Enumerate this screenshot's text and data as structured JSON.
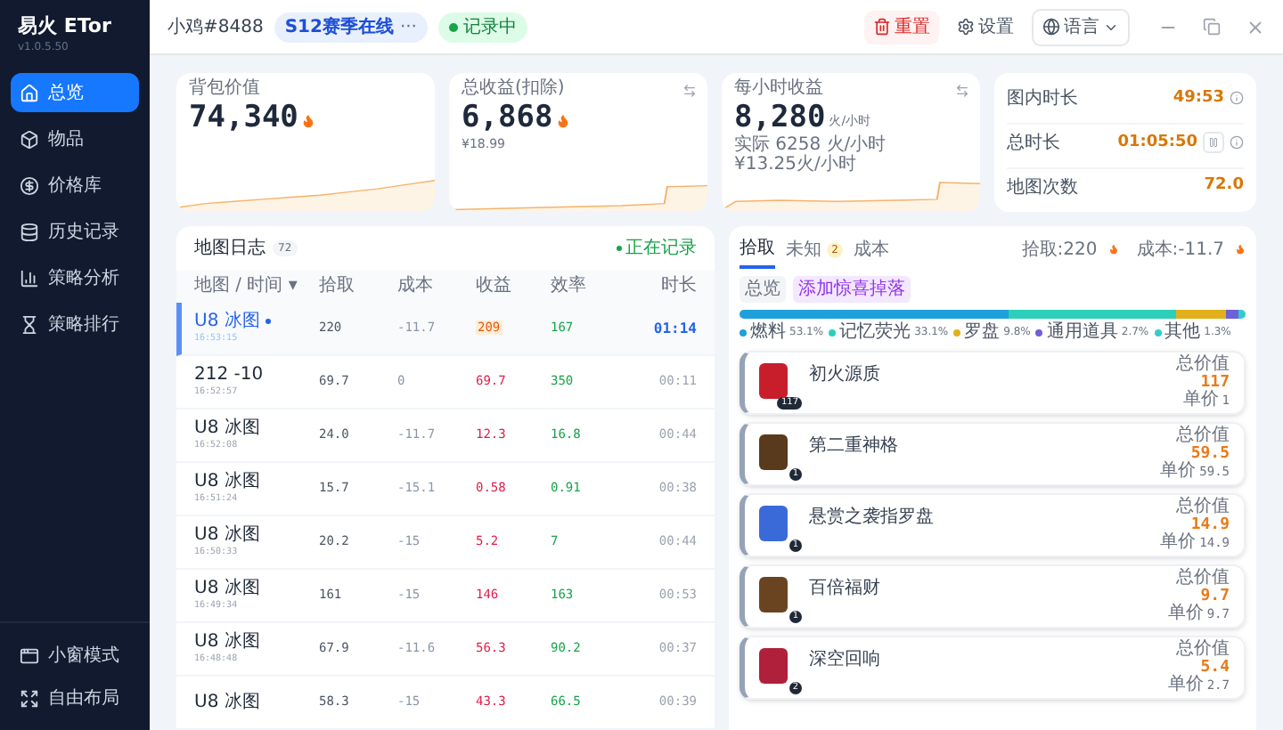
{
  "app": {
    "title": "易火 ETor",
    "version": "v1.0.5.50"
  },
  "sidebar": {
    "items": [
      {
        "label": "总览",
        "selected": true
      },
      {
        "label": "物品",
        "selected": false
      },
      {
        "label": "价格库",
        "selected": false
      },
      {
        "label": "历史记录",
        "selected": false
      },
      {
        "label": "策略分析",
        "selected": false
      },
      {
        "label": "策略排行",
        "selected": false
      }
    ],
    "bottom_items": [
      {
        "label": "小窗模式"
      },
      {
        "label": "自由布局"
      }
    ]
  },
  "header": {
    "user": "小鸡#8488",
    "season": "S12赛季在线",
    "season_more": "···",
    "recording": "记录中",
    "reset": "重置",
    "settings": "设置",
    "language": "语言"
  },
  "stats": [
    {
      "label": "背包价值",
      "value": "74,340",
      "swap": false
    },
    {
      "label": "总收益(扣除)",
      "value": "6,868",
      "sub": [
        "¥18.99"
      ],
      "swap": true
    },
    {
      "label": "每小时收益",
      "value": "8,280",
      "unit": "火/小时",
      "sub": [
        "实际 6258 火/小时",
        "¥13.25火/小时"
      ],
      "swap": true
    }
  ],
  "timers": [
    {
      "label": "图内时长",
      "value": "49:53",
      "pause": false,
      "info": true
    },
    {
      "label": "总时长",
      "value": "01:05:50",
      "pause": true,
      "info": true
    },
    {
      "label": "地图次数",
      "value": "72.0",
      "pause": false,
      "info": false
    }
  ],
  "map_log": {
    "title": "地图日志",
    "count": "72",
    "status": "正在记录",
    "columns": [
      "地图 / 时间 ▾",
      "拾取",
      "成本",
      "收益",
      "效率",
      "时长"
    ],
    "rows": [
      {
        "name": "U8 冰图",
        "time": "16:53:15",
        "pickup": "220",
        "cost": "-11.7",
        "profit": "209",
        "rate": "167",
        "duration": "01:14",
        "selected": true
      },
      {
        "name": "212 -10",
        "time": "16:52:57",
        "pickup": "69.7",
        "cost": "0",
        "profit": "69.7",
        "rate": "350",
        "duration": "00:11",
        "selected": false
      },
      {
        "name": "U8 冰图",
        "time": "16:52:08",
        "pickup": "24.0",
        "cost": "-11.7",
        "profit": "12.3",
        "rate": "16.8",
        "duration": "00:44",
        "selected": false
      },
      {
        "name": "U8 冰图",
        "time": "16:51:24",
        "pickup": "15.7",
        "cost": "-15.1",
        "profit": "0.58",
        "rate": "0.91",
        "duration": "00:38",
        "selected": false
      },
      {
        "name": "U8 冰图",
        "time": "16:50:33",
        "pickup": "20.2",
        "cost": "-15",
        "profit": "5.2",
        "rate": "7",
        "duration": "00:44",
        "selected": false
      },
      {
        "name": "U8 冰图",
        "time": "16:49:34",
        "pickup": "161",
        "cost": "-15",
        "profit": "146",
        "rate": "163",
        "duration": "00:53",
        "selected": false
      },
      {
        "name": "U8 冰图",
        "time": "16:48:48",
        "pickup": "67.9",
        "cost": "-11.6",
        "profit": "56.3",
        "rate": "90.2",
        "duration": "00:37",
        "selected": false
      },
      {
        "name": "U8 冰图",
        "pickup": "58.3",
        "cost": "-15",
        "profit": "43.3",
        "rate": "66.5",
        "duration": "00:39",
        "selected": false
      }
    ]
  },
  "loot": {
    "tabs": [
      {
        "label": "拾取",
        "selected": true
      },
      {
        "label": "未知",
        "badge": "2",
        "selected": false
      },
      {
        "label": "成本",
        "selected": false
      }
    ],
    "pickup_total": "拾取:220",
    "cost_total": "成本:-11.7",
    "chips": [
      {
        "label": "总览",
        "kind": "plain"
      },
      {
        "label": "添加惊喜掉落",
        "kind": "accent"
      }
    ],
    "breakdown": [
      {
        "label": "燃料",
        "percent": "53.1%",
        "color": "#1ea0dc"
      },
      {
        "label": "记忆荧光",
        "percent": "33.1%",
        "color": "#2dcfb8"
      },
      {
        "label": "罗盘",
        "percent": "9.8%",
        "color": "#e2b01c"
      },
      {
        "label": "通用道具",
        "percent": "2.7%",
        "color": "#6f5fd8"
      },
      {
        "label": "其他",
        "percent": "1.3%",
        "color": "#33cccc"
      }
    ],
    "items": [
      {
        "name": "初火源质",
        "count": "117",
        "value_label": "总价值",
        "value": "117",
        "unit_label": "单价",
        "unit": "1",
        "color": "#c81e2c"
      },
      {
        "name": "第二重神格",
        "count": "1",
        "value_label": "总价值",
        "value": "59.5",
        "unit_label": "单价",
        "unit": "59.5",
        "color": "#5a3a1c"
      },
      {
        "name": "悬赏之袭指罗盘",
        "count": "1",
        "value_label": "总价值",
        "value": "14.9",
        "unit_label": "单价",
        "unit": "14.9",
        "color": "#3a6ad8"
      },
      {
        "name": "百倍福财",
        "count": "1",
        "value_label": "总价值",
        "value": "9.7",
        "unit_label": "单价",
        "unit": "9.7",
        "color": "#6a4420"
      },
      {
        "name": "深空回响",
        "count": "2",
        "value_label": "总价值",
        "value": "5.4",
        "unit_label": "单价",
        "unit": "2.7",
        "color": "#b0203a"
      }
    ]
  }
}
